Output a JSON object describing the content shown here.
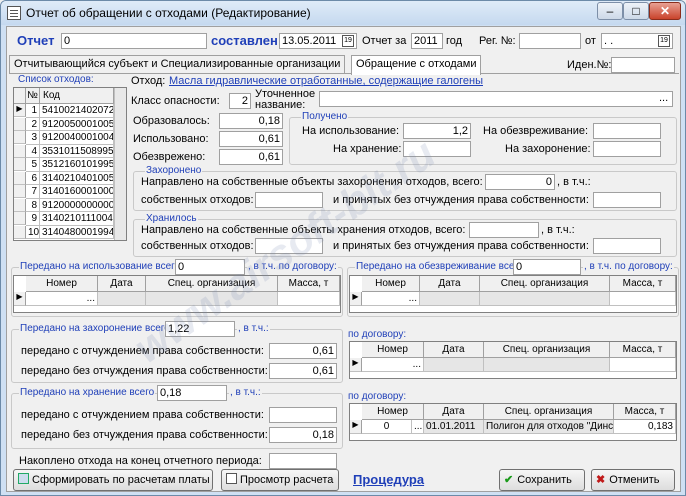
{
  "window": {
    "title": "Отчет об обращении с отходами (Редактирование)",
    "min": "–",
    "max": "□",
    "close": "✕"
  },
  "header": {
    "report_label": "Отчет",
    "report_no": "0",
    "composed_label": "составлен",
    "composed_date": "13.05.2011",
    "period_label": "Отчет за",
    "year": "2011",
    "year_label": "год",
    "reg_label": "Рег. №:",
    "reg_value": "",
    "from_label": "от",
    "from_date": ".   .",
    "ident_label": "Иден.№:",
    "ident_value": ""
  },
  "tabs": [
    {
      "label": "Отчитывающийся субъект и Специализированные организации"
    },
    {
      "label": "Обращение с отходами"
    }
  ],
  "waste_list": {
    "label": "Список отходов:",
    "col_num": "№",
    "col_code": "Код",
    "rows": [
      {
        "n": "1",
        "code": "5410021402072"
      },
      {
        "n": "2",
        "code": "9120050001005"
      },
      {
        "n": "3",
        "code": "9120040001004"
      },
      {
        "n": "4",
        "code": "3531011508995"
      },
      {
        "n": "5",
        "code": "3512160101995"
      },
      {
        "n": "6",
        "code": "3140210401005"
      },
      {
        "n": "7",
        "code": "3140160001000"
      },
      {
        "n": "8",
        "code": "9120000000000"
      },
      {
        "n": "9",
        "code": "3140210111004"
      },
      {
        "n": "10",
        "code": "3140480001994"
      }
    ]
  },
  "waste": {
    "label": "Отход:",
    "name": "Масла гидравлические отработанные, содержащие галогены",
    "class_label": "Класс опасности:",
    "class_value": "2",
    "refined_label": "Уточненное название:",
    "refined_value": "",
    "ellipsis": "..."
  },
  "amounts": {
    "formed_label": "Образовалось:",
    "formed": "0,18",
    "used_label": "Использовано:",
    "used": "0,61",
    "neutralized_label": "Обезврежено:",
    "neutralized": "0,61"
  },
  "received": {
    "label": "Получено",
    "use_label": "На использование:",
    "use": "1,2",
    "neut_label": "На обезвреживание:",
    "neut": "",
    "store_label": "На хранение:",
    "store": "",
    "bury_label": "На захоронение:",
    "bury": ""
  },
  "buried": {
    "label": "Захоронено",
    "line1": "Направлено на собственные объекты захоронения отходов, всего:",
    "total": "0",
    "incl": ", в т.ч.:",
    "own_label": "собственных отходов:",
    "own": "",
    "accepted_label": "и принятых без отчуждения права собственности:",
    "accepted": ""
  },
  "stored": {
    "label": "Хранилось",
    "line1": "Направлено на собственные объекты хранения отходов, всего:",
    "total": "",
    "incl": ", в т.ч.:",
    "own_label": "собственных отходов:",
    "own": "",
    "accepted_label": "и принятых без отчуждения права собственности:",
    "accepted": ""
  },
  "transfer_use": {
    "label": "Передано на использование всего",
    "value": "0",
    "incl": ", в т.ч. по договору:"
  },
  "transfer_neut": {
    "label": "Передано на обезвреживание всего",
    "value": "0",
    "incl": ", в т.ч. по договору:"
  },
  "grid_cols": {
    "num": "Номер",
    "date": "Дата",
    "org": "Спец. организация",
    "mass": "Масса, т"
  },
  "grid_use": {
    "num": "",
    "date": "",
    "org": "",
    "mass": "",
    "ellipsis": "..."
  },
  "grid_neut": {
    "num": "",
    "date": "",
    "org": "",
    "mass": "",
    "ellipsis": "..."
  },
  "transfer_bury": {
    "label": "Передано на захоронение всего",
    "value": "1,22",
    "incl": ", в т.ч.:",
    "with_label": "передано с отчуждением права собственности:",
    "with": "0,61",
    "without_label": "передано без отчуждения права собственности:",
    "without": "0,61",
    "contract_label": "по договору:"
  },
  "grid_bury": {
    "num": "",
    "date": "",
    "org": "",
    "mass": "",
    "ellipsis": "..."
  },
  "transfer_store": {
    "label": "Передано на хранение всего",
    "value": "0,18",
    "incl": ", в т.ч.:",
    "with_label": "передано с отчуждением права собственности:",
    "with": "",
    "without_label": "передано без отчуждения права собственности:",
    "without": "0,18",
    "contract_label": "по договору:"
  },
  "grid_store": {
    "num": "0",
    "date": "01.01.2011",
    "org": "Полигон для отходов \"Динской",
    "mass": "0,183",
    "ellipsis": "..."
  },
  "accumulated": {
    "label": "Накоплено отхода на конец отчетного периода:",
    "value": ""
  },
  "buttons": {
    "form": "Сформировать по расчетам платы",
    "view": "Просмотр расчета",
    "procedure": "Процедура",
    "save": "Сохранить",
    "cancel": "Отменить"
  },
  "watermark": "www.airsoft-bit.ru"
}
